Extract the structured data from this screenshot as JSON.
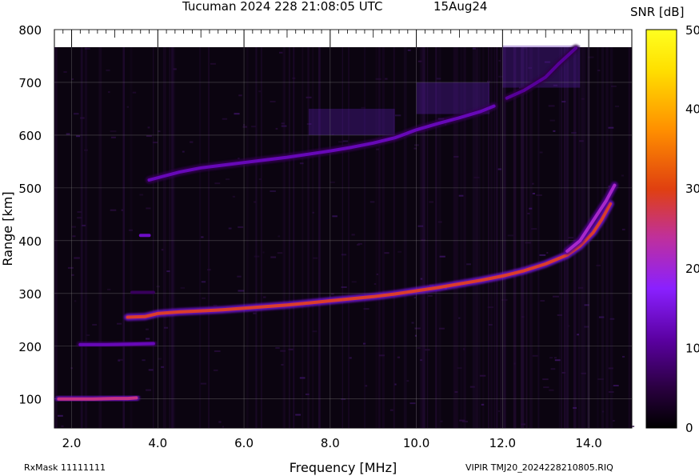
{
  "chart_data": {
    "type": "heatmap",
    "title": "Tucuman 2024 228 21:08:05 UTC",
    "date_label": "15Aug24",
    "xlabel": "Frequency [MHz]",
    "ylabel": "Range [km]",
    "xlim": [
      1.6,
      15.0
    ],
    "ylim": [
      45,
      800
    ],
    "x_ticks": [
      "2.0",
      "4.0",
      "6.0",
      "8.0",
      "10.0",
      "12.0",
      "14.0"
    ],
    "x_tick_values": [
      2.0,
      4.0,
      6.0,
      8.0,
      10.0,
      12.0,
      14.0
    ],
    "y_ticks": [
      "100",
      "200",
      "300",
      "400",
      "500",
      "600",
      "700",
      "800"
    ],
    "y_tick_values": [
      100,
      200,
      300,
      400,
      500,
      600,
      700,
      800
    ],
    "colorbar": {
      "label": "SNR [dB]",
      "range": [
        0,
        50
      ],
      "ticks": [
        "0",
        "10",
        "20",
        "30",
        "40",
        "50"
      ],
      "tick_values": [
        0,
        10,
        20,
        30,
        40,
        50
      ],
      "colors": [
        "#000000",
        "#2a0040",
        "#5a00a0",
        "#8a20ff",
        "#c0309a",
        "#e04010",
        "#ff9000",
        "#ffe000",
        "#ffff20"
      ]
    },
    "grid": true,
    "traces": [
      {
        "name": "",
        "points": [
          [
            1.7,
            100
          ],
          [
            2.0,
            100
          ],
          [
            2.5,
            100
          ],
          [
            3.0,
            101
          ],
          [
            3.3,
            101
          ],
          [
            3.5,
            102
          ]
        ],
        "snr": 26
      },
      {
        "name": "",
        "points": [
          [
            2.2,
            203
          ],
          [
            2.8,
            203
          ],
          [
            3.4,
            204
          ],
          [
            3.9,
            205
          ]
        ],
        "snr": 14
      },
      {
        "name": "",
        "points": [
          [
            3.3,
            255
          ],
          [
            3.7,
            256
          ],
          [
            4.0,
            262
          ],
          [
            4.5,
            265
          ],
          [
            5.0,
            267
          ],
          [
            5.5,
            269
          ],
          [
            6.0,
            272
          ],
          [
            6.5,
            275
          ],
          [
            7.0,
            278
          ],
          [
            7.5,
            282
          ],
          [
            8.0,
            286
          ],
          [
            8.5,
            290
          ],
          [
            9.0,
            294
          ],
          [
            9.5,
            299
          ],
          [
            10.0,
            305
          ],
          [
            10.5,
            311
          ],
          [
            11.0,
            318
          ],
          [
            11.5,
            325
          ],
          [
            12.0,
            333
          ],
          [
            12.5,
            343
          ],
          [
            13.0,
            356
          ],
          [
            13.5,
            373
          ],
          [
            13.8,
            390
          ],
          [
            14.1,
            415
          ],
          [
            14.3,
            440
          ],
          [
            14.5,
            470
          ]
        ],
        "snr": 30
      },
      {
        "name": "",
        "points": [
          [
            13.5,
            380
          ],
          [
            13.8,
            400
          ],
          [
            14.0,
            425
          ],
          [
            14.2,
            450
          ],
          [
            14.4,
            475
          ],
          [
            14.6,
            505
          ]
        ],
        "snr": 22
      },
      {
        "name": "",
        "points": [
          [
            3.6,
            410
          ],
          [
            3.8,
            410
          ]
        ],
        "snr": 15
      },
      {
        "name": "",
        "points": [
          [
            3.4,
            302
          ],
          [
            3.9,
            302
          ]
        ],
        "snr": 8
      },
      {
        "name": "",
        "points": [
          [
            3.8,
            515
          ],
          [
            4.5,
            530
          ],
          [
            5.0,
            538
          ],
          [
            5.5,
            543
          ],
          [
            6.0,
            548
          ],
          [
            6.5,
            553
          ],
          [
            7.0,
            558
          ],
          [
            7.5,
            564
          ],
          [
            8.0,
            570
          ],
          [
            8.5,
            577
          ],
          [
            9.0,
            585
          ],
          [
            9.5,
            595
          ],
          [
            10.0,
            610
          ],
          [
            10.5,
            622
          ],
          [
            11.0,
            633
          ],
          [
            11.5,
            645
          ],
          [
            11.8,
            655
          ]
        ],
        "snr": 14
      },
      {
        "name": "",
        "points": [
          [
            12.1,
            670
          ],
          [
            12.5,
            685
          ],
          [
            13.0,
            710
          ],
          [
            13.3,
            735
          ],
          [
            13.7,
            765
          ]
        ],
        "snr": 12
      }
    ]
  },
  "footer": {
    "left": "RxMask 11111111",
    "right": "VIPIR  TMJ20_2024228210805.RIQ"
  }
}
